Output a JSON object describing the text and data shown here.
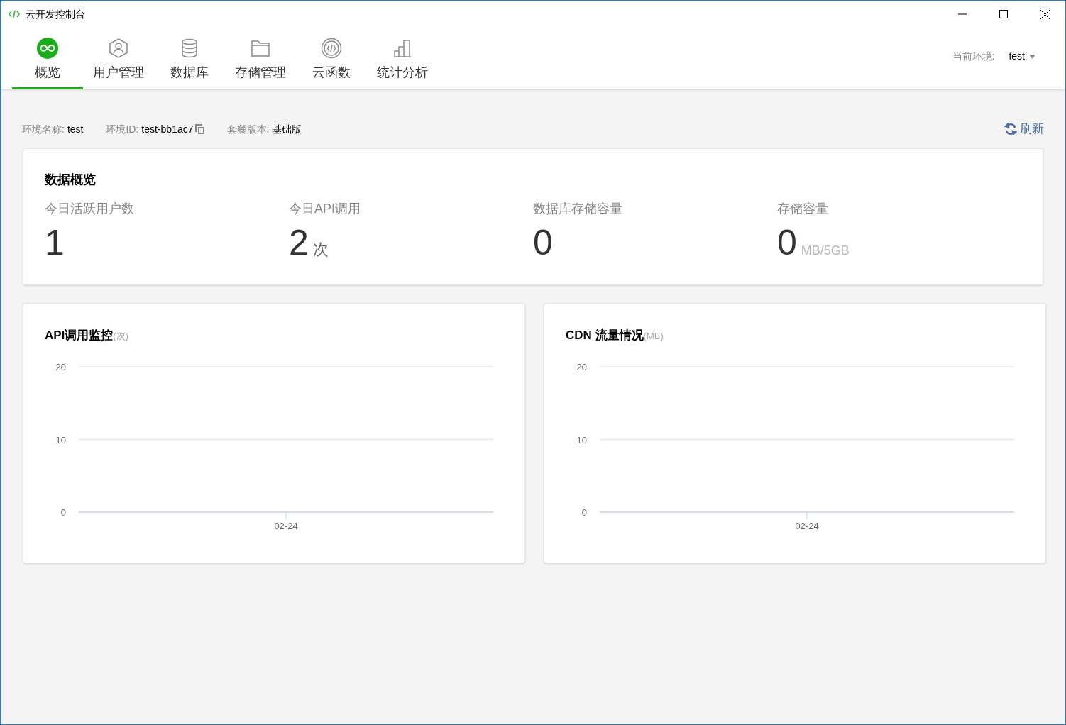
{
  "window": {
    "title": "云开发控制台"
  },
  "tabs": [
    {
      "label": "概览",
      "selected": true
    },
    {
      "label": "用户管理",
      "selected": false
    },
    {
      "label": "数据库",
      "selected": false
    },
    {
      "label": "存储管理",
      "selected": false
    },
    {
      "label": "云函数",
      "selected": false
    },
    {
      "label": "统计分析",
      "selected": false
    }
  ],
  "environment": {
    "label": "当前环境:",
    "value": "test"
  },
  "info": [
    {
      "label": "环境名称:",
      "value": "test"
    },
    {
      "label": "环境ID:",
      "value": "test-bb1ac7",
      "copyable": true
    },
    {
      "label": "套餐版本:",
      "value": "基础版"
    }
  ],
  "refresh": "刷新",
  "overview": {
    "title": "数据概览",
    "stats": [
      {
        "label": "今日活跃用户数",
        "value": "1"
      },
      {
        "label": "今日API调用",
        "value": "2",
        "unit": "次"
      },
      {
        "label": "数据库存储容量",
        "value": "0"
      },
      {
        "label": "存储容量",
        "value": "0",
        "unit": "MB/5GB"
      }
    ]
  },
  "charts": [
    {
      "title": "API调用监控",
      "unit": "(次)",
      "chart_data": {
        "type": "line",
        "categories": [
          "02-24"
        ],
        "ylim": [
          0,
          20
        ],
        "yticks": [
          0,
          10,
          20
        ]
      }
    },
    {
      "title": "CDN 流量情况",
      "unit": "(MB)",
      "chart_data": {
        "type": "line",
        "categories": [
          "02-24"
        ],
        "ylim": [
          0,
          20
        ],
        "yticks": [
          0,
          10,
          20
        ]
      }
    }
  ]
}
